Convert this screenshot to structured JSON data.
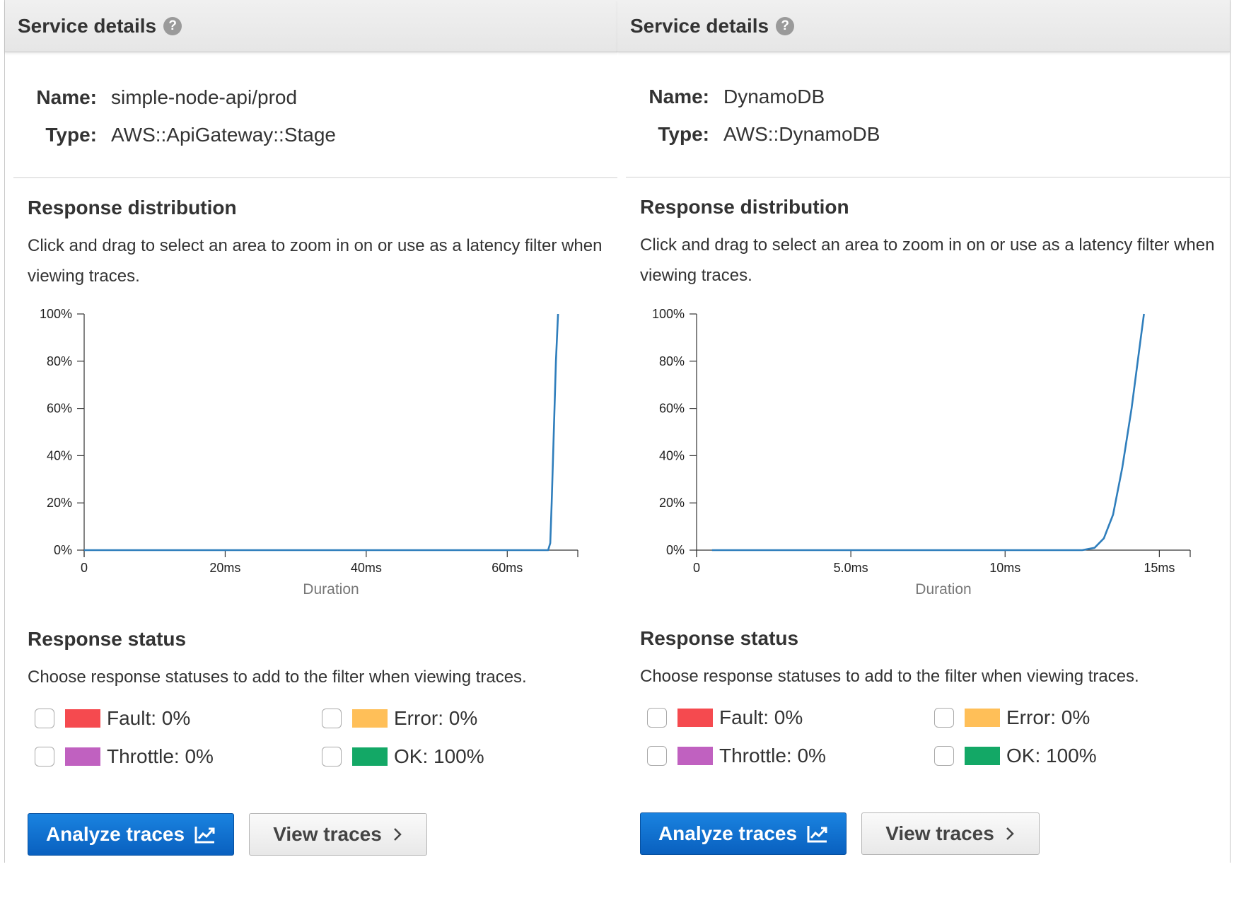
{
  "panels": [
    {
      "header": "Service details",
      "help_icon": "?",
      "name_label": "Name:",
      "name_value": "simple-node-api/prod",
      "type_label": "Type:",
      "type_value": "AWS::ApiGateway::Stage",
      "response_distribution": {
        "title": "Response distribution",
        "description": "Click and drag to select an area to zoom in on or use as a latency filter when viewing traces."
      },
      "chart_data": {
        "type": "line",
        "xlabel": "Duration",
        "ylabel": "",
        "x_unit": "ms",
        "xlim": [
          0,
          70
        ],
        "ylim": [
          0,
          100
        ],
        "x_ticks": [
          0,
          20,
          40,
          60
        ],
        "x_tick_labels": [
          "0",
          "20ms",
          "40ms",
          "60ms"
        ],
        "y_ticks": [
          0,
          20,
          40,
          60,
          80,
          100
        ],
        "y_tick_labels": [
          "0%",
          "20%",
          "40%",
          "60%",
          "80%",
          "100%"
        ],
        "series": [
          {
            "color": "#2f7ebc",
            "points": [
              [
                0,
                0
              ],
              [
                30,
                0
              ],
              [
                60,
                0
              ],
              [
                65.8,
                0
              ],
              [
                66.1,
                3
              ],
              [
                66.3,
                20
              ],
              [
                66.6,
                50
              ],
              [
                66.9,
                80
              ],
              [
                67.2,
                100
              ]
            ]
          }
        ]
      },
      "response_status": {
        "title": "Response status",
        "description": "Choose response statuses to add to the filter when viewing traces.",
        "items": [
          {
            "label": "Fault: 0%",
            "color": "#f54a4f"
          },
          {
            "label": "Error: 0%",
            "color": "#ffbf58"
          },
          {
            "label": "Throttle: 0%",
            "color": "#c061c0"
          },
          {
            "label": "OK: 100%",
            "color": "#13a866"
          }
        ]
      },
      "buttons": {
        "analyze": "Analyze traces",
        "view": "View traces"
      }
    },
    {
      "header": "Service details",
      "help_icon": "?",
      "name_label": "Name:",
      "name_value": "DynamoDB",
      "type_label": "Type:",
      "type_value": "AWS::DynamoDB",
      "response_distribution": {
        "title": "Response distribution",
        "description": "Click and drag to select an area to zoom in on or use as a latency filter when viewing traces."
      },
      "chart_data": {
        "type": "line",
        "xlabel": "Duration",
        "ylabel": "",
        "x_unit": "ms",
        "xlim": [
          0,
          16
        ],
        "ylim": [
          0,
          100
        ],
        "x_ticks": [
          0,
          5,
          10,
          15
        ],
        "x_tick_labels": [
          "0",
          "5.0ms",
          "10ms",
          "15ms"
        ],
        "y_ticks": [
          0,
          20,
          40,
          60,
          80,
          100
        ],
        "y_tick_labels": [
          "0%",
          "20%",
          "40%",
          "60%",
          "80%",
          "100%"
        ],
        "series": [
          {
            "color": "#2f7ebc",
            "points": [
              [
                0.5,
                0
              ],
              [
                6,
                0
              ],
              [
                12.5,
                0
              ],
              [
                12.9,
                1
              ],
              [
                13.2,
                5
              ],
              [
                13.5,
                15
              ],
              [
                13.8,
                35
              ],
              [
                14.1,
                60
              ],
              [
                14.35,
                85
              ],
              [
                14.5,
                100
              ]
            ]
          }
        ]
      },
      "response_status": {
        "title": "Response status",
        "description": "Choose response statuses to add to the filter when viewing traces.",
        "items": [
          {
            "label": "Fault: 0%",
            "color": "#f54a4f"
          },
          {
            "label": "Error: 0%",
            "color": "#ffbf58"
          },
          {
            "label": "Throttle: 0%",
            "color": "#c061c0"
          },
          {
            "label": "OK: 100%",
            "color": "#13a866"
          }
        ]
      },
      "buttons": {
        "analyze": "Analyze traces",
        "view": "View traces"
      }
    }
  ]
}
